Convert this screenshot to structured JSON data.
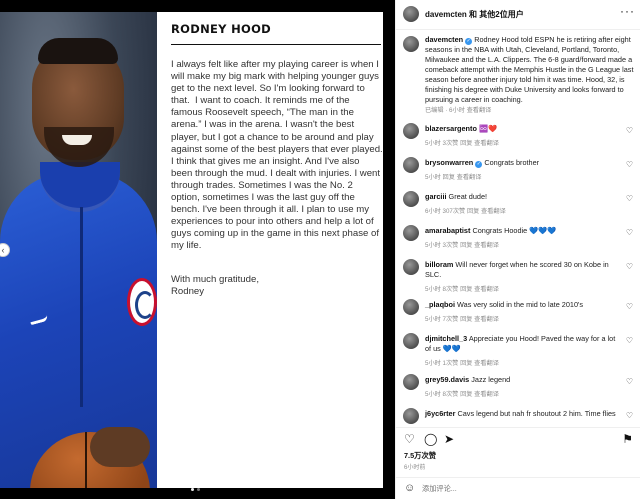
{
  "header": {
    "username": "davemcten 和 其他2位用户",
    "more_icon": "more-options-icon"
  },
  "post": {
    "name": "RODNEY HOOD",
    "body": "I always felt like after my playing career is when I will make my big mark with helping younger guys get to the next level. So I'm looking forward to that.  I want to coach. It reminds me of the famous Roosevelt speech, “The man in the arena.” I was in the arena. I wasn't the best player, but I got a chance to be around and play against some of the best players that ever played. I think that gives me an insight. And I've also been through the mud. I dealt with injuries. I went through trades. Sometimes I was the No. 2 option, sometimes I was the last guy off the bench. I've been through it all. I plan to use my experiences to pour into others and help a lot of guys coming up in the game in this next phase of my life.",
    "signoff": "With much gratitude,\nRodney"
  },
  "caption": {
    "user": "davemcten",
    "text": "Rodney Hood told ESPN he is retiring after eight seasons in the NBA with Utah, Cleveland, Portland, Toronto, Milwaukee and the L.A. Clippers. The 6-8 guard/forward made a comeback attempt with the Memphis Hustle in the G League last season before another injury told him it was time. Hood, 32, is finishing his degree with Duke University and looks forward to pursuing a career in coaching.",
    "meta": "已编辑 · 6小时   查看翻译"
  },
  "comments": [
    {
      "user": "blazersargento",
      "text": "♾️❤️",
      "meta": "5小时   3次赞   回复   查看翻译"
    },
    {
      "user": "brysonwarren",
      "verified": true,
      "text": "Congrats brother",
      "meta": "5小时   回复   查看翻译"
    },
    {
      "user": "garciii",
      "text": "Great dude!",
      "meta": "6小时   307次赞   回复   查看翻译"
    },
    {
      "user": "amarabaptist",
      "text": "Congrats Hoodie 💙💙💙",
      "meta": "5小时   3次赞   回复   查看翻译"
    },
    {
      "user": "billoram",
      "text": "Will never forget when he scored 30 on Kobe in SLC.",
      "meta": "5小时   8次赞   回复   查看翻译"
    },
    {
      "user": "_plaqboi",
      "text": "Was very solid in the mid to late 2010's",
      "meta": "5小时   7次赞   回复   查看翻译"
    },
    {
      "user": "djmitchell_3",
      "text": "Appreciate you Hood! Paved the way for a lot of us 💙💙",
      "meta": "5小时   1次赞   回复   查看翻译"
    },
    {
      "user": "grey59.davis",
      "text": "Jazz legend",
      "meta": "5小时   8次赞   回复   查看翻译"
    },
    {
      "user": "j6yc6rter",
      "text": "Cavs legend but nah fr shoutout 2 him. Time flies",
      "meta": ""
    }
  ],
  "actions": {
    "like_icon": "heart-icon",
    "comment_icon": "comment-icon",
    "share_icon": "send-icon",
    "save_icon": "bookmark-icon"
  },
  "likes": "7.5万次赞",
  "time_ago": "6小时前",
  "add_comment": {
    "placeholder": "添加评论..."
  }
}
